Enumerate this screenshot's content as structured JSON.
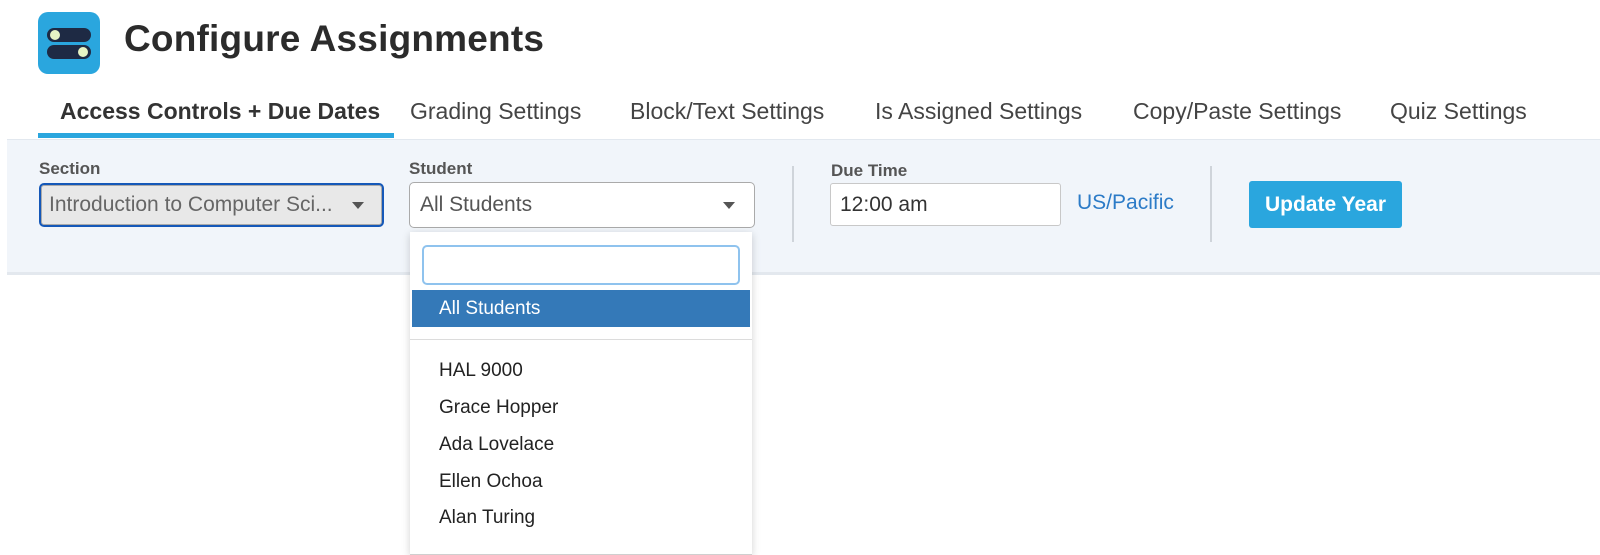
{
  "header": {
    "title": "Configure Assignments",
    "icon": "toggle-switches-icon",
    "icon_color": "#2aa6de"
  },
  "tabs": [
    {
      "label": "Access Controls + Due Dates",
      "active": true
    },
    {
      "label": "Grading Settings",
      "active": false
    },
    {
      "label": "Block/Text Settings",
      "active": false
    },
    {
      "label": "Is Assigned Settings",
      "active": false
    },
    {
      "label": "Copy/Paste Settings",
      "active": false
    },
    {
      "label": "Quiz Settings",
      "active": false
    }
  ],
  "toolbar": {
    "section": {
      "label": "Section",
      "value": "Introduction to Computer Sci..."
    },
    "student": {
      "label": "Student",
      "value": "All Students",
      "dropdown": {
        "search_value": "",
        "selected": "All Students",
        "options": [
          "HAL 9000",
          "Grace Hopper",
          "Ada Lovelace",
          "Ellen Ochoa",
          "Alan Turing"
        ]
      }
    },
    "due_time": {
      "label": "Due Time",
      "value": "12:00 am",
      "timezone": "US/Pacific"
    },
    "update_button": "Update Year"
  },
  "colors": {
    "accent": "#2aa6de",
    "selected_option": "#3479b8",
    "link": "#2c7bc7"
  }
}
